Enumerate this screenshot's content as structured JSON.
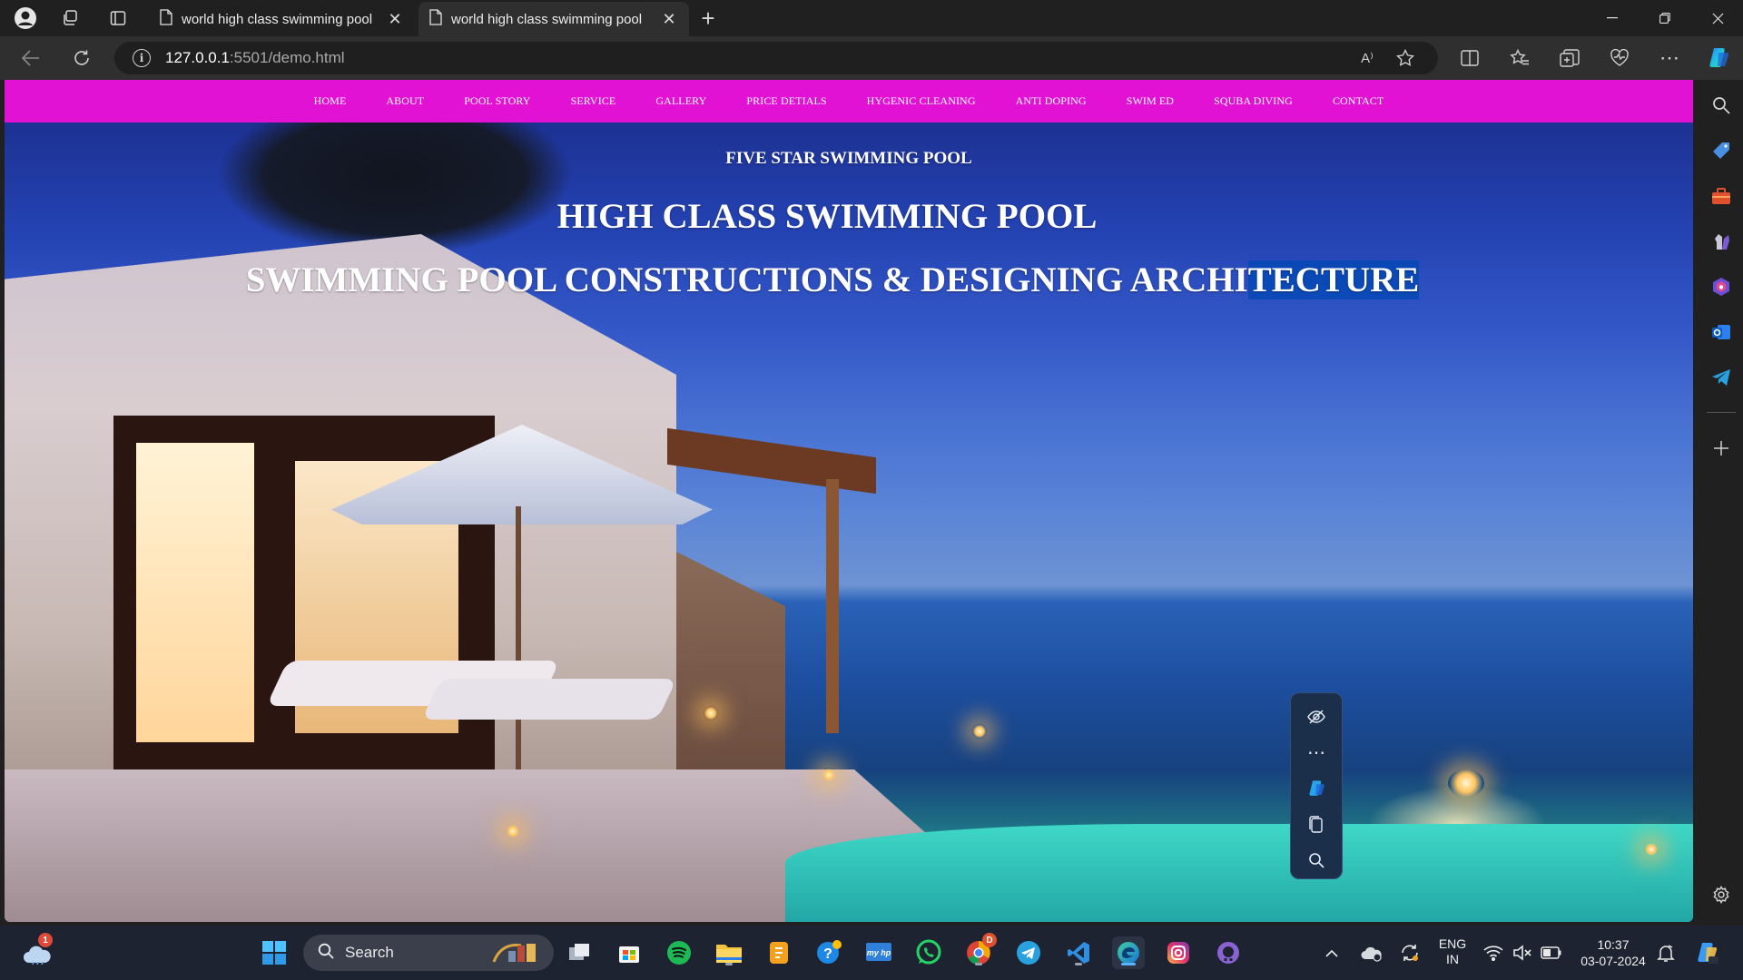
{
  "browser": {
    "tabs": [
      {
        "title": "world high class swimming pool",
        "active": false
      },
      {
        "title": "world high class swimming pool",
        "active": true
      }
    ],
    "new_tab_symbol": "+",
    "url_host": "127.0.0.1",
    "url_rest": ":5501/demo.html",
    "read_aloud_label": "A⁾",
    "icons": [
      "profile-icon",
      "workspaces-icon",
      "vertical-tabs-icon",
      "back-icon",
      "refresh-icon",
      "site-info-icon",
      "read-aloud-icon",
      "favorite-star-icon",
      "split-screen-icon",
      "favorites-icon",
      "collections-icon",
      "browser-essentials-icon",
      "more-icon",
      "copilot-icon"
    ]
  },
  "page": {
    "nav_color": "#e112d4",
    "nav": [
      "HOME",
      "ABOUT",
      "POOL STORY",
      "SERVICE",
      "GALLERY",
      "PRICE DETIALS",
      "HYGENIC CLEANING",
      "ANTI DOPING",
      "SWIM ED",
      "SQUBA DIVING",
      "CONTACT"
    ],
    "eyebrow": "FIVE STAR SWIMMING POOL",
    "title1": "HIGH CLASS SWIMMING POOL",
    "title2_main": "SWIMMING POOL CONSTRUCTIONS & DESIGNING ARCHI",
    "title2_selected": "TECTURE"
  },
  "floating_toolbar": {
    "icons": [
      "hide-eye-icon",
      "more-dots-icon",
      "copilot-icon",
      "copy-icon",
      "search-icon"
    ]
  },
  "sidebar": {
    "icons": [
      "search-icon",
      "shopping-tag-icon",
      "tools-icon",
      "games-icon",
      "office-icon",
      "outlook-icon",
      "telegram-icon",
      "add-icon",
      "settings-icon"
    ]
  },
  "taskbar": {
    "search_label": "Search",
    "weather_badge": "1",
    "chrome_badge": "D",
    "language_top": "ENG",
    "language_bottom": "IN",
    "time": "10:37",
    "date": "03-07-2024",
    "apps": [
      "start-icon",
      "task-view-icon",
      "store-icon",
      "spotify-icon",
      "file-explorer-icon",
      "files-app-icon",
      "help-icon",
      "myhp-icon",
      "whatsapp-icon",
      "chrome-icon",
      "telegram-icon",
      "vscode-icon",
      "edge-icon",
      "instagram-icon",
      "github-icon"
    ],
    "colors": {
      "spotify": "#1db954",
      "whatsapp": "#25d366",
      "telegram": "#2aa1df",
      "vscode": "#2f8fe0",
      "explorer": "#f3c23b"
    }
  }
}
